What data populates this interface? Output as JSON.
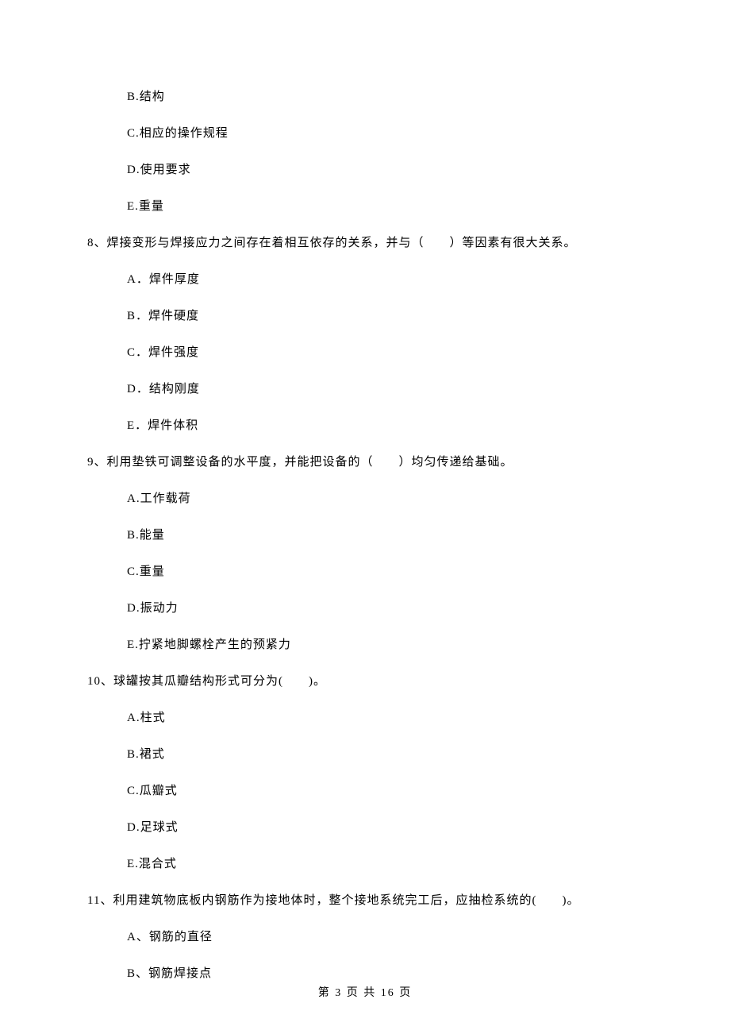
{
  "q7_options": {
    "b": "B.结构",
    "c": "C.相应的操作规程",
    "d": "D.使用要求",
    "e": "E.重量"
  },
  "q8": {
    "stem": "8、焊接变形与焊接应力之间存在着相互依存的关系，并与（　　）等因素有很大关系。",
    "a": "A．焊件厚度",
    "b": "B．焊件硬度",
    "c": "C．焊件强度",
    "d": "D．结构刚度",
    "e": "E．焊件体积"
  },
  "q9": {
    "stem": "9、利用垫铁可调整设备的水平度，并能把设备的（　　）均匀传递给基础。",
    "a": "A.工作载荷",
    "b": "B.能量",
    "c": "C.重量",
    "d": "D.振动力",
    "e": "E.拧紧地脚螺栓产生的预紧力"
  },
  "q10": {
    "stem": "10、球罐按其瓜瓣结构形式可分为(　　)。",
    "a": "A.柱式",
    "b": "B.裙式",
    "c": "C.瓜瓣式",
    "d": "D.足球式",
    "e": "E.混合式"
  },
  "q11": {
    "stem": "11、利用建筑物底板内钢筋作为接地体时，整个接地系统完工后，应抽检系统的(　　)。",
    "a": "A、钢筋的直径",
    "b": "B、钢筋焊接点"
  },
  "footer": "第 3 页 共 16 页"
}
